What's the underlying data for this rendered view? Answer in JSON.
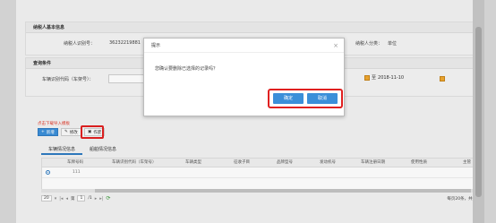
{
  "taxpayer_info": {
    "title": "纳税人基本信息",
    "taxpayer_id_label": "纳税人识别号：",
    "taxpayer_id_value": "36232219881",
    "taxpayer_type_label": "纳税人分类：",
    "taxpayer_type_value": "单位"
  },
  "query": {
    "title": "查询条件",
    "vin_label": "车辆识别代码（车架号）：",
    "date_prefix": "至",
    "date_value": "2018-11-10"
  },
  "toolbar": {
    "import_template_link": "点击下载导入模板",
    "add_label": "新增",
    "edit_label": "修改",
    "delete_label": "作废"
  },
  "tabs": [
    {
      "label": "车辆情况信息"
    },
    {
      "label": "船舶情况信息"
    }
  ],
  "grid": {
    "columns": [
      "车牌号码",
      "车辆识别代码（车架号）",
      "车辆类型",
      "征收子目",
      "品牌型号",
      "发动机号",
      "车辆注册日期",
      "使用性质",
      "主管"
    ],
    "rows": [
      {
        "plate": "111",
        "vin": "",
        "type": "",
        "sub": "",
        "brand": "",
        "engine": "",
        "reg": "",
        "usage": ""
      }
    ]
  },
  "pager": {
    "page_size": "20",
    "page_prefix": "第",
    "page_value": "1",
    "page_total": "/1",
    "info": "每页20条，共1条"
  },
  "dialog": {
    "title": "提示",
    "message": "您确认要删除已选择的记录吗？",
    "confirm_label": "确定",
    "cancel_label": "取消"
  },
  "colors": {
    "primary": "#3b8fd9",
    "highlight": "#e02020",
    "link_red": "#e03a2a"
  }
}
